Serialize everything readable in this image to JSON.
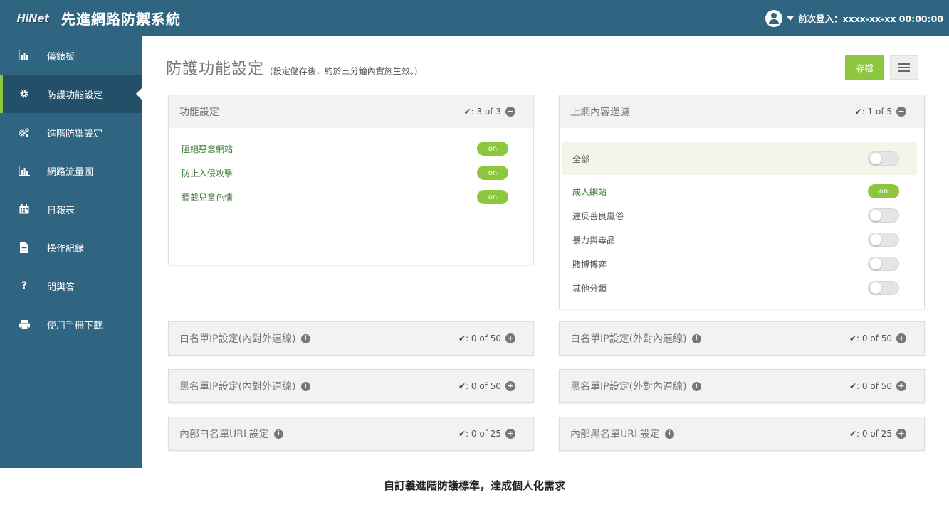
{
  "header": {
    "logo_text": "HiNet",
    "app_title": "先進網路防禦系統",
    "last_login": "前次登入：xxxx-xx-xx 00:00:00"
  },
  "sidebar": {
    "items": [
      {
        "label": "儀錶板",
        "icon": "chart-bar-icon"
      },
      {
        "label": "防護功能設定",
        "icon": "gear-icon",
        "active": true
      },
      {
        "label": "進階防禦設定",
        "icon": "gears-icon"
      },
      {
        "label": "網路流量圖",
        "icon": "chart-bar-icon"
      },
      {
        "label": "日報表",
        "icon": "calendar-icon"
      },
      {
        "label": "操作紀錄",
        "icon": "document-icon"
      },
      {
        "label": "問與答",
        "icon": "question-icon"
      },
      {
        "label": "使用手冊下載",
        "icon": "print-icon"
      }
    ]
  },
  "page": {
    "title": "防護功能設定",
    "note": "(設定儲存後，約於三分鐘內實施生效。)",
    "save_label": "存檔"
  },
  "panels": {
    "function": {
      "title": "功能設定",
      "count": "3 of 3",
      "rows": [
        {
          "label": "阻絕惡意網站",
          "state": "on"
        },
        {
          "label": "防止入侵攻擊",
          "state": "on"
        },
        {
          "label": "攔截兒童色情",
          "state": "on"
        }
      ]
    },
    "content": {
      "title": "上網內容過濾",
      "count": "1 of 5",
      "all_label": "全部",
      "rows": [
        {
          "label": "成人網站",
          "state": "on"
        },
        {
          "label": "違反善良風俗",
          "state": "off"
        },
        {
          "label": "暴力與毒品",
          "state": "off"
        },
        {
          "label": "賭博博弈",
          "state": "off"
        },
        {
          "label": "其他分類",
          "state": "off"
        }
      ]
    },
    "whitelist_ip_out": {
      "title": "白名單IP設定(內對外連線)",
      "count": "0 of 50"
    },
    "whitelist_ip_in": {
      "title": "白名單IP設定(外對內連線)",
      "count": "0 of 50"
    },
    "blacklist_ip_out": {
      "title": "黑名單IP設定(內對外連線)",
      "count": "0 of 50"
    },
    "blacklist_ip_in": {
      "title": "黑名單IP設定(外對內連線)",
      "count": "0 of 50"
    },
    "whitelist_url": {
      "title": "內部白名單URL設定",
      "count": "0 of 25"
    },
    "blacklist_url": {
      "title": "內部黑名單URL設定",
      "count": "0 of 25"
    }
  },
  "switch_on_label": "on",
  "caption": "自訂義進階防護標準，達成個人化需求",
  "colors": {
    "nav_bg": "#306582",
    "accent": "#8dc63f",
    "active_bg": "#234f69"
  }
}
